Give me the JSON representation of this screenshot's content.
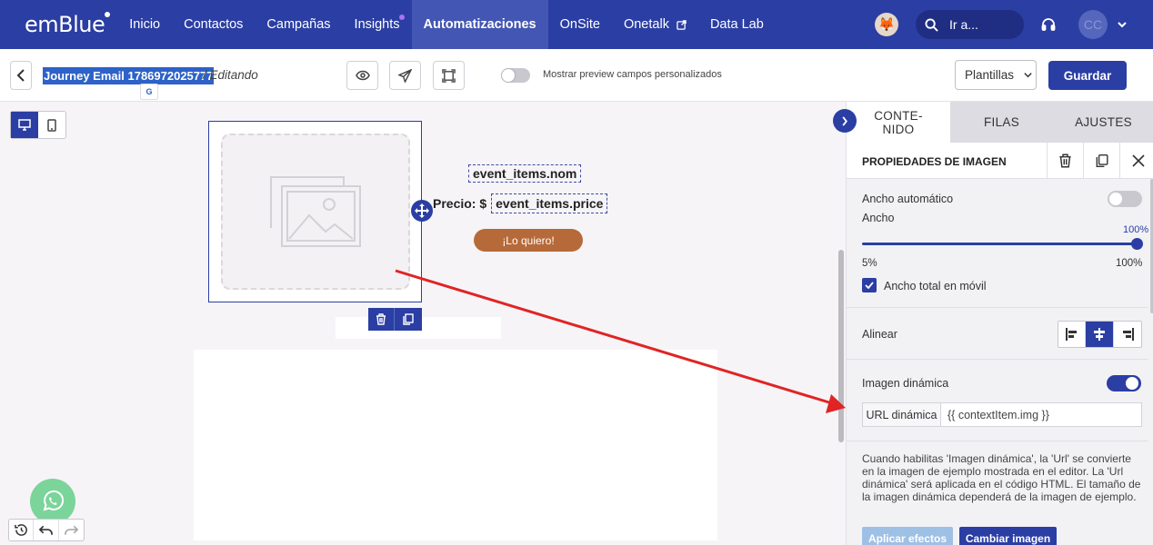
{
  "nav": {
    "logo": "emBlue",
    "items": [
      {
        "label": "Inicio"
      },
      {
        "label": "Contactos"
      },
      {
        "label": "Campañas"
      },
      {
        "label": "Insights"
      },
      {
        "label": "Automatizaciones"
      },
      {
        "label": "OnSite"
      },
      {
        "label": "Onetalk"
      },
      {
        "label": "Data Lab"
      }
    ],
    "search_placeholder": "Ir a...",
    "user_initials": "CC",
    "accent": "#2b3ea3"
  },
  "editor": {
    "journey_title": "Journey Email 1786972025777",
    "status": "/ Editando",
    "preview_toggle_label": "Mostrar preview campos personalizados",
    "templates_label": "Plantillas",
    "save_label": "Guardar"
  },
  "canvas": {
    "product_name_tag": "event_items.nom",
    "price_label": "Precio: $",
    "price_tag": "event_items.price",
    "cta_label": "¡Lo quiero!",
    "cta_color": "#b66a39"
  },
  "panel": {
    "tabs": [
      {
        "label": "CONTE-\nNIDO"
      },
      {
        "label": "FILAS"
      },
      {
        "label": "AJUSTES"
      }
    ],
    "title": "PROPIEDADES DE IMAGEN",
    "auto_width_label": "Ancho automático",
    "width_label": "Ancho",
    "width_value": "100%",
    "width_min": "5%",
    "width_max": "100%",
    "mobile_full_width_label": "Ancho total en móvil",
    "align_label": "Alinear",
    "dynamic_image_label": "Imagen dinámica",
    "dynamic_url_label": "URL dinámica",
    "dynamic_url_value": "{{ contextItem.img }}",
    "help_text": "Cuando habilitas 'Imagen dinámica', la 'Url' se convierte en la imagen de ejemplo mostrada en el editor. La 'Url dinámica' será aplicada en el código HTML. El tamaño de la imagen dinámica dependerá de la imagen de ejemplo.",
    "apply_effects_label": "Aplicar efectos",
    "change_image_label": "Cambiar imagen"
  }
}
